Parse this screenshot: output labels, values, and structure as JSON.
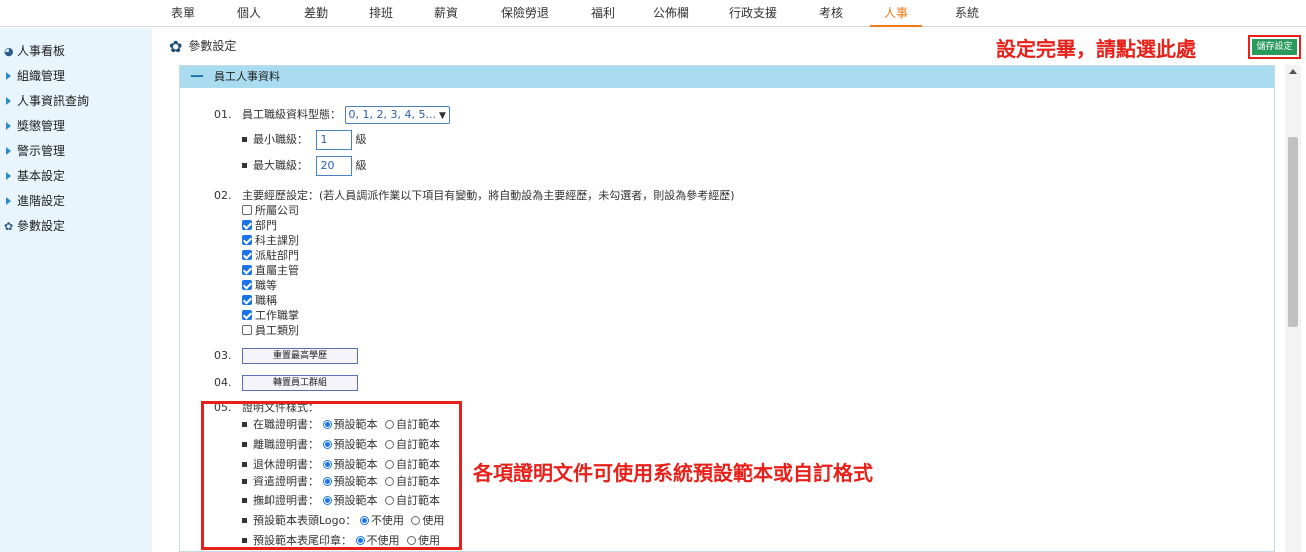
{
  "topnav": {
    "items": [
      "表單",
      "個人",
      "差勤",
      "排班",
      "薪資",
      "保險勞退",
      "福利",
      "公佈欄",
      "行政支援",
      "考核",
      "人事",
      "系統"
    ],
    "active_index": 10
  },
  "sidebar": {
    "items": [
      {
        "label": "人事看板",
        "icon": "pie-chart-icon"
      },
      {
        "label": "組織管理",
        "icon": "triangle-right-icon"
      },
      {
        "label": "人事資訊查詢",
        "icon": "triangle-right-icon"
      },
      {
        "label": "獎懲管理",
        "icon": "triangle-right-icon"
      },
      {
        "label": "警示管理",
        "icon": "triangle-right-icon"
      },
      {
        "label": "基本設定",
        "icon": "triangle-right-icon"
      },
      {
        "label": "進階設定",
        "icon": "triangle-right-icon"
      },
      {
        "label": "參數設定",
        "icon": "gear-icon"
      }
    ]
  },
  "page": {
    "title": "參數設定",
    "note_top": "設定完畢，請點選此處",
    "save_label": "儲存設定",
    "note_mid": "各項證明文件可使用系統預設範本或自訂格式"
  },
  "panel": {
    "title": "員工人事資料",
    "item01": {
      "num": "01.",
      "label": "員工職級資料型態：",
      "select_value": "0, 1, 2, 3, 4, 5...",
      "min_label": "最小職級：",
      "min_value": "1",
      "max_label": "最大職級：",
      "max_value": "20",
      "unit": "級"
    },
    "item02": {
      "num": "02.",
      "label": "主要經歷設定：(若人員調派作業以下項目有變動，將自動設為主要經歷，未勾選者，則設為參考經歷)",
      "options": [
        {
          "label": "所屬公司",
          "checked": false
        },
        {
          "label": "部門",
          "checked": true
        },
        {
          "label": "科主課別",
          "checked": true
        },
        {
          "label": "派駐部門",
          "checked": true
        },
        {
          "label": "直屬主管",
          "checked": true
        },
        {
          "label": "職等",
          "checked": true
        },
        {
          "label": "職稱",
          "checked": true
        },
        {
          "label": "工作職掌",
          "checked": true
        },
        {
          "label": "員工類別",
          "checked": false
        }
      ]
    },
    "item03": {
      "num": "03.",
      "button": "重置最高學歷"
    },
    "item04": {
      "num": "04.",
      "button": "轉置員工群組"
    },
    "item05": {
      "num": "05.",
      "label": "證明文件樣式：",
      "rows": [
        {
          "label": "在職證明書：",
          "opt1": "預設範本",
          "opt2": "自訂範本",
          "selected": 1
        },
        {
          "label": "離職證明書：",
          "opt1": "預設範本",
          "opt2": "自訂範本",
          "selected": 1
        },
        {
          "label": "退休證明書：",
          "opt1": "預設範本",
          "opt2": "自訂範本",
          "selected": 1
        },
        {
          "label": "資遣證明書：",
          "opt1": "預設範本",
          "opt2": "自訂範本",
          "selected": 1
        },
        {
          "label": "撫卹證明書：",
          "opt1": "預設範本",
          "opt2": "自訂範本",
          "selected": 1
        },
        {
          "label": "預設範本表頭Logo：",
          "opt1": "不使用",
          "opt2": "使用",
          "selected": 1
        },
        {
          "label": "預設範本表尾印章：",
          "opt1": "不使用",
          "opt2": "使用",
          "selected": 1
        }
      ]
    }
  }
}
